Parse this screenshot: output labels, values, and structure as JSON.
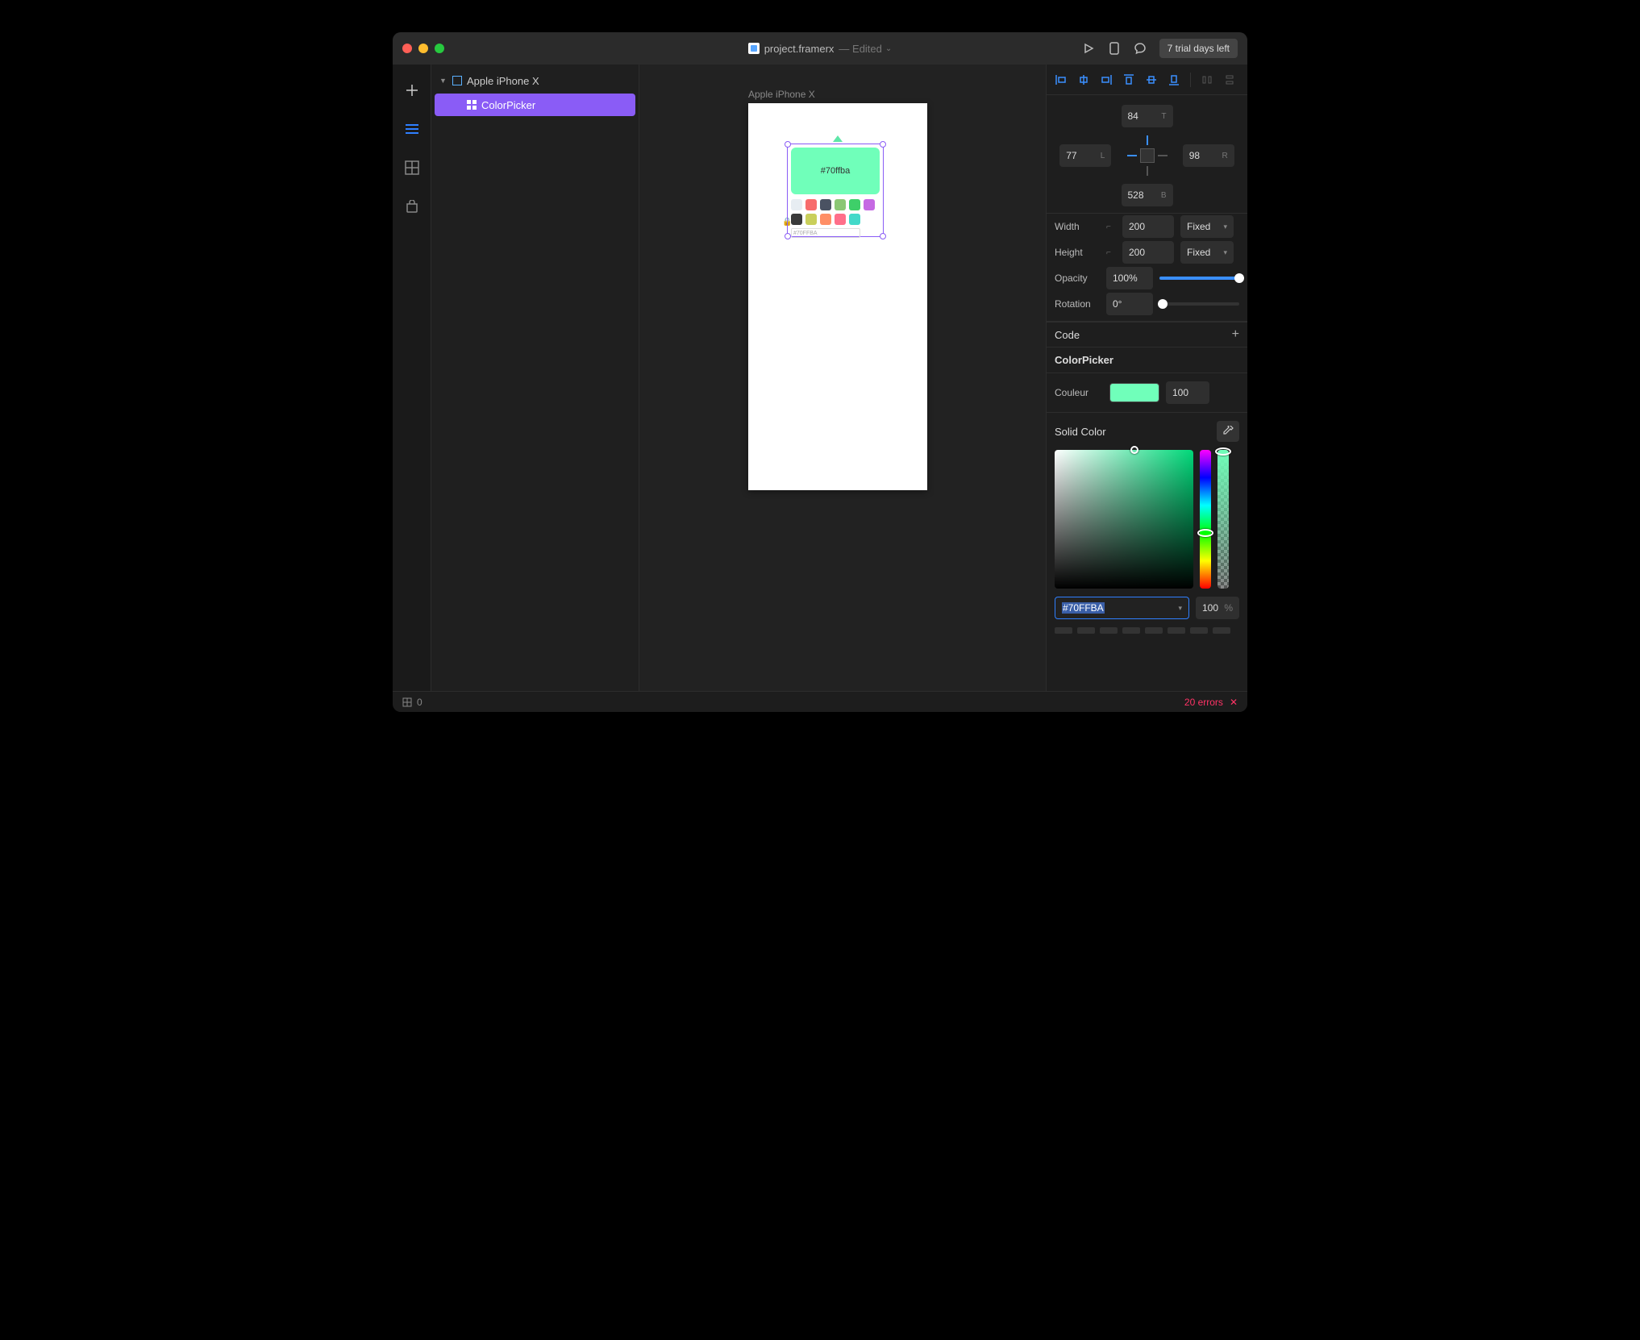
{
  "titlebar": {
    "filename": "project.framerx",
    "edited": "— Edited",
    "trial": "7 trial days left"
  },
  "layers": {
    "root": "Apple iPhone X",
    "child": "ColorPicker"
  },
  "canvas": {
    "artboard_label": "Apple iPhone X",
    "swatch_hex": "#70ffba",
    "mini_hex": "#70FFBA",
    "palette": [
      "#e7edf2",
      "#f76c6c",
      "#4a5262",
      "#8bc774",
      "#3ecf69",
      "#c569e3",
      "#3a3a3a",
      "#c9cf5b",
      "#ff8f66",
      "#ff6f8a",
      "#43d9c9"
    ]
  },
  "inspector": {
    "pos": {
      "t": "84",
      "l": "77",
      "r": "98",
      "b": "528"
    },
    "width_label": "Width",
    "width": "200",
    "width_mode": "Fixed",
    "height_label": "Height",
    "height": "200",
    "height_mode": "Fixed",
    "opacity_label": "Opacity",
    "opacity": "100%",
    "rotation_label": "Rotation",
    "rotation": "0°",
    "code_section": "Code",
    "component_name": "ColorPicker",
    "couleur_label": "Couleur",
    "couleur_alpha": "100",
    "solid_label": "Solid Color",
    "hex": "#70FFBA",
    "alpha_pct": "100",
    "alpha_unit": "%"
  },
  "status": {
    "left_count": "0",
    "errors": "20 errors"
  }
}
